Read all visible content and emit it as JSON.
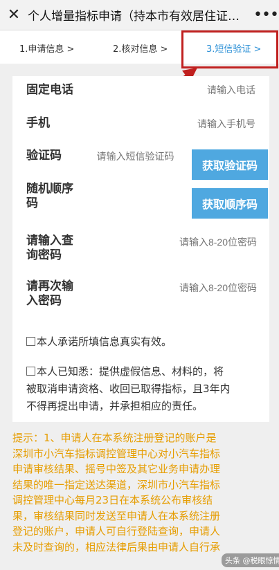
{
  "header": {
    "close_icon": "close-icon",
    "title": "个人增量指标申请（持本市有效居住证的…",
    "more_icon": "more-icon"
  },
  "steps": [
    {
      "label": "1.申请信息 >",
      "active": false
    },
    {
      "label": "2.核对信息 >",
      "active": false
    },
    {
      "label": "3.短信验证 >",
      "active": true
    }
  ],
  "annotation": {
    "color": "#c0201f"
  },
  "form": {
    "landline": {
      "label": "固定电话",
      "placeholder": "请输入电话"
    },
    "mobile": {
      "label": "手机",
      "placeholder": "请输入手机号"
    },
    "sms_code": {
      "label": "验证码",
      "placeholder": "请输入短信验证码",
      "button": "获取验证码"
    },
    "random_code": {
      "label_line1": "随机顺序",
      "label_line2": "码",
      "button": "获取顺序码"
    },
    "query_password": {
      "label_line1": "请输入查",
      "label_line2": "询密码",
      "placeholder": "请输入8-20位密码"
    },
    "confirm_password": {
      "label_line1": "请再次输",
      "label_line2": "入密码",
      "placeholder": "请输入8-20位密码"
    }
  },
  "agreements": {
    "truthful": "本人承诺所填信息真实有效。",
    "aware_line1": "本人已知悉：提供虚假信息、材料的，将",
    "aware_line2": "被取消申请资格、收回已取得指标，且3年内",
    "aware_line3": "不得再提出申请，并承担相应的责任。"
  },
  "notice": {
    "line1": "提示：1、申请人在本系统注册登记的账户是",
    "line2": "深圳市小汽车指标调控管理中心对小汽车指标",
    "line3": "申请审核结果、摇号中签及其它业务申请办理",
    "line4": "结果的唯一指定送达渠道，深圳市小汽车指标",
    "line5": "调控管理中心每月23日在本系统公布审核结",
    "line6": "果，审核结果同时发送至申请人在本系统注册",
    "line7": "登记的账户，申请人可自行登陆查询，申请人",
    "line8": "未及时查询的，相应法律后果由申请人自行承"
  },
  "watermark": "头条 @税眼惊情",
  "colors": {
    "accent": "#2a8fd6",
    "button": "#4fa8e0",
    "notice": "#e69d00",
    "annotation": "#c0201f"
  }
}
